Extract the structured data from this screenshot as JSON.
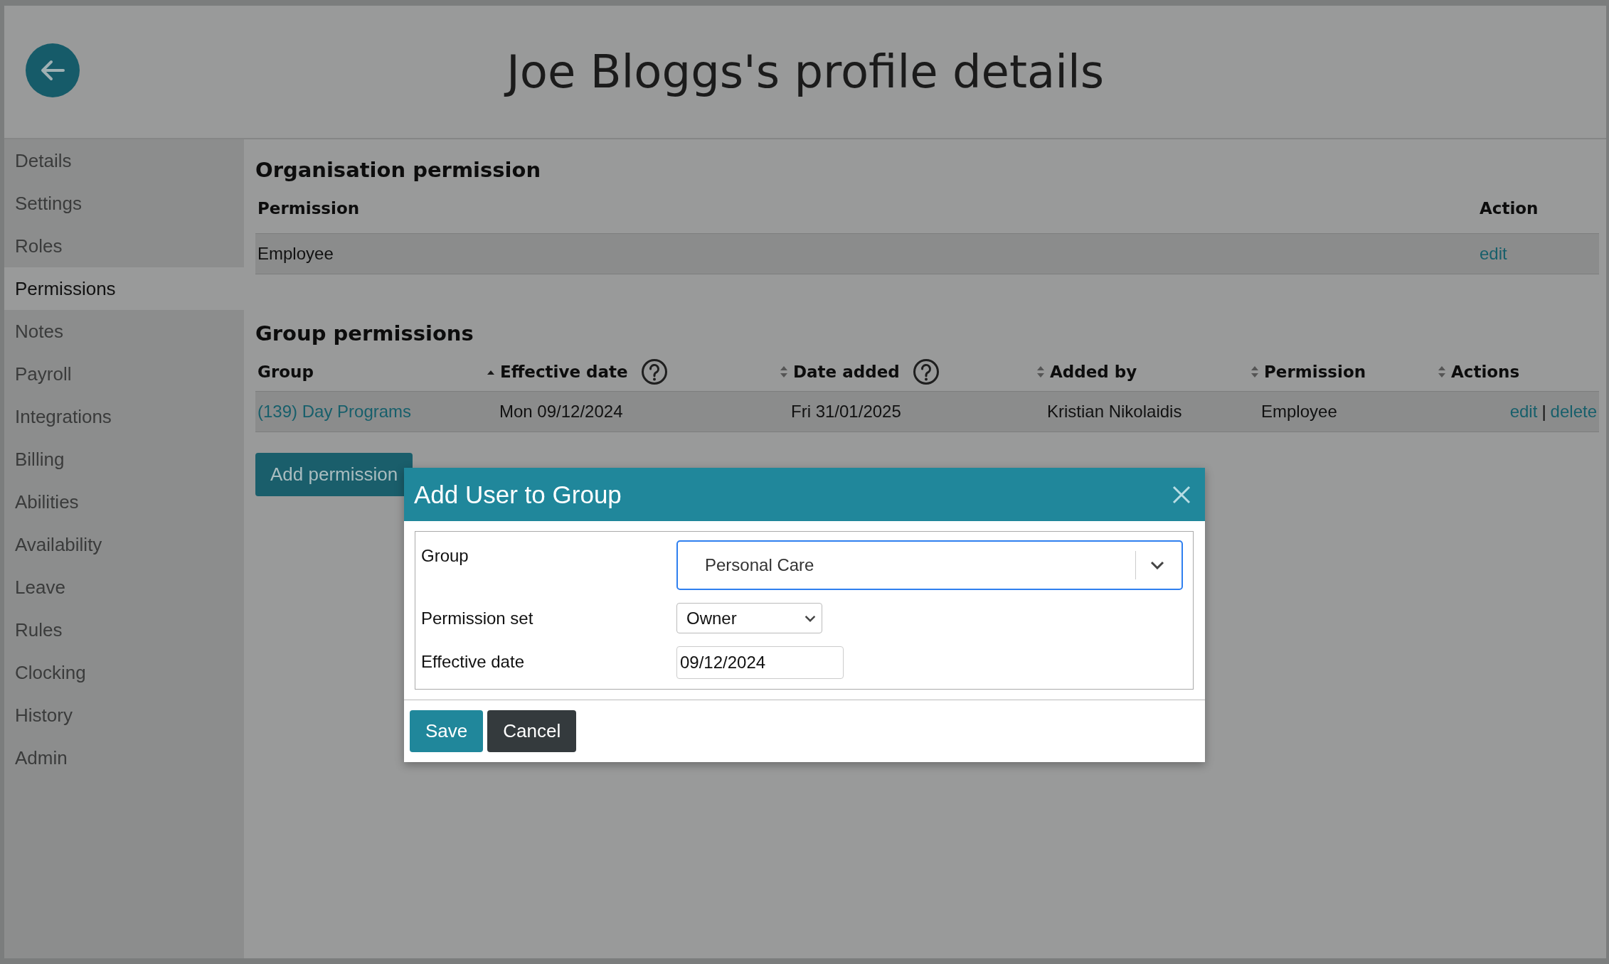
{
  "header": {
    "title": "Joe Bloggs's profile details"
  },
  "sidebar": {
    "items": [
      {
        "label": "Details",
        "selected": false
      },
      {
        "label": "Settings",
        "selected": false
      },
      {
        "label": "Roles",
        "selected": false
      },
      {
        "label": "Permissions",
        "selected": true
      },
      {
        "label": "Notes",
        "selected": false
      },
      {
        "label": "Payroll",
        "selected": false
      },
      {
        "label": "Integrations",
        "selected": false
      },
      {
        "label": "Billing",
        "selected": false
      },
      {
        "label": "Abilities",
        "selected": false
      },
      {
        "label": "Availability",
        "selected": false
      },
      {
        "label": "Leave",
        "selected": false
      },
      {
        "label": "Rules",
        "selected": false
      },
      {
        "label": "Clocking",
        "selected": false
      },
      {
        "label": "History",
        "selected": false
      },
      {
        "label": "Admin",
        "selected": false
      }
    ]
  },
  "organisation_permission": {
    "heading": "Organisation permission",
    "columns": [
      "Permission",
      "Action"
    ],
    "rows": [
      {
        "permission": "Employee",
        "action": "edit"
      }
    ]
  },
  "group_permissions": {
    "heading": "Group permissions",
    "columns": [
      {
        "label": "Group",
        "sortable": false,
        "help": false
      },
      {
        "label": "Effective date",
        "sortable": true,
        "sorted": true,
        "help": true
      },
      {
        "label": "Date added",
        "sortable": true,
        "sorted": false,
        "help": true
      },
      {
        "label": "Added by",
        "sortable": true,
        "sorted": false,
        "help": false
      },
      {
        "label": "Permission",
        "sortable": true,
        "sorted": false,
        "help": false
      },
      {
        "label": "Actions",
        "sortable": true,
        "sorted": false,
        "help": false
      }
    ],
    "rows": [
      {
        "group": "(139) Day Programs",
        "effective_date": "Mon 09/12/2024",
        "date_added": "Fri 31/01/2025",
        "added_by": "Kristian Nikolaidis",
        "permission": "Employee",
        "actions": [
          "edit",
          "delete"
        ],
        "action_separator": "|"
      }
    ],
    "add_button": "Add permission"
  },
  "dialog": {
    "title": "Add User to Group",
    "fields": [
      {
        "kind": "combobox",
        "label": "Group",
        "value": "Personal Care",
        "focused": true
      },
      {
        "kind": "select",
        "label": "Permission set",
        "value": "Owner",
        "focused": false
      },
      {
        "kind": "date",
        "label": "Effective date",
        "value": "09/12/2024",
        "focused": false
      }
    ],
    "buttons": [
      {
        "kind": "primary",
        "label": "Save"
      },
      {
        "kind": "secondary",
        "label": "Cancel"
      }
    ]
  }
}
